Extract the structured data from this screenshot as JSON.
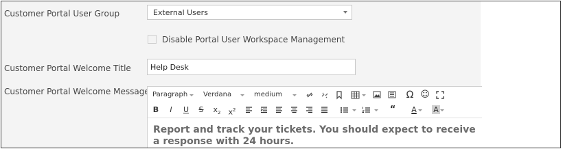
{
  "form": {
    "user_group_label": "Customer Portal User Group",
    "user_group_value": "External Users",
    "disable_workspace_label": "Disable Portal User Workspace Management",
    "welcome_title_label": "Customer Portal Welcome Title",
    "welcome_title_value": "Help Desk",
    "welcome_message_label": "Customer Portal Welcome Message"
  },
  "editor": {
    "format_value": "Paragraph",
    "font_value": "Verdana",
    "size_value": "medium",
    "content": "Report and track your tickets. You should expect to receive a response with 24 hours.",
    "toolbar_icons": [
      "link-icon",
      "unlink-icon",
      "bookmark-icon",
      "table-icon",
      "image-icon",
      "media-icon",
      "omega-icon",
      "smiley-icon",
      "fullscreen-icon",
      "bold-icon",
      "italic-icon",
      "underline-icon",
      "strikethrough-icon",
      "subscript-icon",
      "superscript-icon",
      "align-left-icon",
      "indent-icon",
      "align-center-left-icon",
      "align-center-icon",
      "align-right-icon",
      "justify-icon",
      "bullet-list-icon",
      "numbered-list-icon",
      "blockquote-icon",
      "font-color-icon",
      "background-color-icon"
    ]
  },
  "colors": {
    "panel_bg": "#f4f4f4",
    "border": "#3a3a3a",
    "content_text": "#6b6b6b"
  }
}
